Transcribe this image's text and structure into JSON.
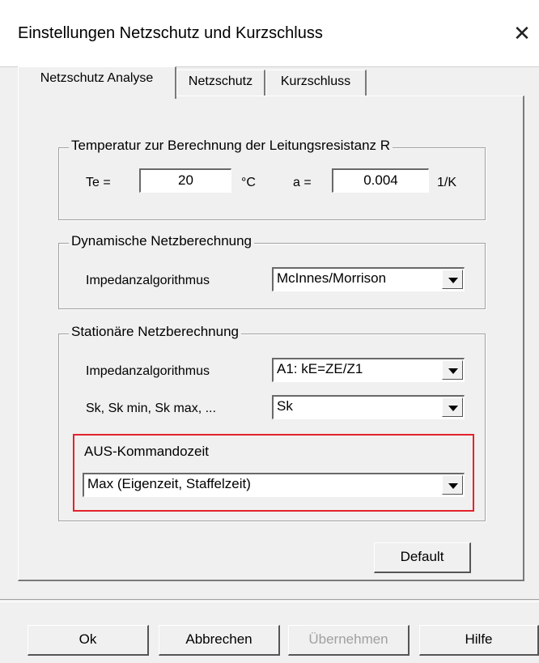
{
  "window": {
    "title": "Einstellungen Netzschutz und Kurzschluss",
    "close_glyph": "✕"
  },
  "tabs": [
    {
      "label": "Netzschutz Analyse",
      "active": true
    },
    {
      "label": "Netzschutz",
      "active": false
    },
    {
      "label": "Kurzschluss",
      "active": false
    }
  ],
  "temperature": {
    "legend": "Temperatur zur Berechnung der Leitungsresistanz R",
    "te_label": "Te =",
    "te_value": "20",
    "te_unit": "°C",
    "a_label": "a =",
    "a_value": "0.004",
    "a_unit": "1/K"
  },
  "dynamic": {
    "legend": "Dynamische Netzberechnung",
    "impedance_label": "Impedanzalgorithmus",
    "impedance_value": "McInnes/Morrison"
  },
  "stationary": {
    "legend": "Stationäre Netzberechnung",
    "impedance_label": "Impedanzalgorithmus",
    "impedance_value": "A1: kE=ZE/Z1",
    "sk_label": "Sk, Sk min, Sk max, ...",
    "sk_value": "Sk",
    "aus_label": "AUS-Kommandozeit",
    "aus_value": "Max (Eigenzeit, Staffelzeit)"
  },
  "buttons": {
    "default": "Default",
    "ok": "Ok",
    "cancel": "Abbrechen",
    "apply": "Übernehmen",
    "help": "Hilfe"
  },
  "colors": {
    "highlight": "#e3232c",
    "dialog_bg": "#f0f0f0"
  }
}
